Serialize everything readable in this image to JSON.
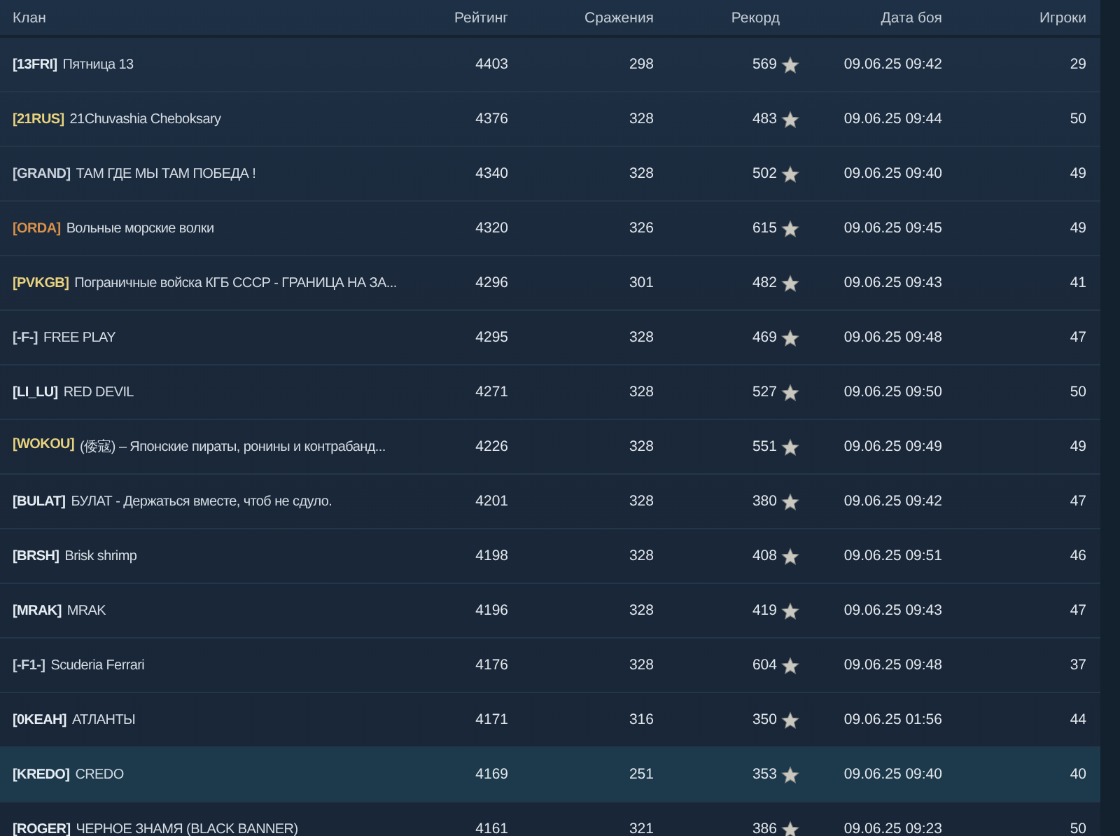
{
  "table": {
    "columns": [
      "Клан",
      "Рейтинг",
      "Сражения",
      "Рекорд",
      "Дата боя",
      "Игроки"
    ],
    "rows": [
      {
        "tag": "[13FRI]",
        "color": "#e6edf3",
        "name": "Пятница 13",
        "rating": "4403",
        "battles": "298",
        "record": "569",
        "date": "09.06.25 09:42",
        "players": "29",
        "selected": false
      },
      {
        "tag": "[21RUS]",
        "color": "#e8d27e",
        "name": "21Chuvashia Cheboksary",
        "rating": "4376",
        "battles": "328",
        "record": "483",
        "date": "09.06.25 09:44",
        "players": "50",
        "selected": false
      },
      {
        "tag": "[GRAND]",
        "color": "#c9d2db",
        "name": "ТАМ ГДЕ МЫ ТАМ ПОБЕДА !",
        "rating": "4340",
        "battles": "328",
        "record": "502",
        "date": "09.06.25 09:40",
        "players": "49",
        "selected": false
      },
      {
        "tag": "[ORDA]",
        "color": "#d9914a",
        "name": "Вольные морские волки",
        "rating": "4320",
        "battles": "326",
        "record": "615",
        "date": "09.06.25 09:45",
        "players": "49",
        "selected": false
      },
      {
        "tag": "[PVKGB]",
        "color": "#e8d27e",
        "name": "Пограничные войска КГБ СССР - ГРАНИЦА НА ЗА...",
        "rating": "4296",
        "battles": "301",
        "record": "482",
        "date": "09.06.25 09:43",
        "players": "41",
        "selected": false
      },
      {
        "tag": "[-F-]",
        "color": "#c9d2db",
        "name": "FREE PLAY",
        "rating": "4295",
        "battles": "328",
        "record": "469",
        "date": "09.06.25 09:48",
        "players": "47",
        "selected": false
      },
      {
        "tag": "[LI_LU]",
        "color": "#e6edf3",
        "name": "RED DEVIL",
        "rating": "4271",
        "battles": "328",
        "record": "527",
        "date": "09.06.25 09:50",
        "players": "50",
        "selected": false
      },
      {
        "tag": "[WOKOU]",
        "color": "#e8d27e",
        "name": "(倭寇) – Японские пираты, ронины и контрабанд...",
        "rating": "4226",
        "battles": "328",
        "record": "551",
        "date": "09.06.25 09:49",
        "players": "49",
        "selected": false
      },
      {
        "tag": "[BULAT]",
        "color": "#e6edf3",
        "name": "БУЛАТ - Держаться вместе, чтоб не сдуло.",
        "rating": "4201",
        "battles": "328",
        "record": "380",
        "date": "09.06.25 09:42",
        "players": "47",
        "selected": false
      },
      {
        "tag": "[BRSH]",
        "color": "#e6edf3",
        "name": "Brisk shrimp",
        "rating": "4198",
        "battles": "328",
        "record": "408",
        "date": "09.06.25 09:51",
        "players": "46",
        "selected": false
      },
      {
        "tag": "[MRAK]",
        "color": "#e6edf3",
        "name": "MRAK",
        "rating": "4196",
        "battles": "328",
        "record": "419",
        "date": "09.06.25 09:43",
        "players": "47",
        "selected": false
      },
      {
        "tag": "[-F1-]",
        "color": "#c9d2db",
        "name": "Scuderia Ferrari",
        "rating": "4176",
        "battles": "328",
        "record": "604",
        "date": "09.06.25 09:48",
        "players": "37",
        "selected": false
      },
      {
        "tag": "[0KEAH]",
        "color": "#e6edf3",
        "name": "АТЛАНТЫ",
        "rating": "4171",
        "battles": "316",
        "record": "350",
        "date": "09.06.25 01:56",
        "players": "44",
        "selected": false
      },
      {
        "tag": "[KREDO]",
        "color": "#e6edf3",
        "name": "CREDO",
        "rating": "4169",
        "battles": "251",
        "record": "353",
        "date": "09.06.25 09:40",
        "players": "40",
        "selected": true
      },
      {
        "tag": "[ROGER]",
        "color": "#e6edf3",
        "name": "ЧЕРНОЕ ЗНАМЯ (BLACK BANNER)",
        "rating": "4161",
        "battles": "321",
        "record": "386",
        "date": "09.06.25 09:23",
        "players": "50",
        "selected": false
      }
    ]
  }
}
